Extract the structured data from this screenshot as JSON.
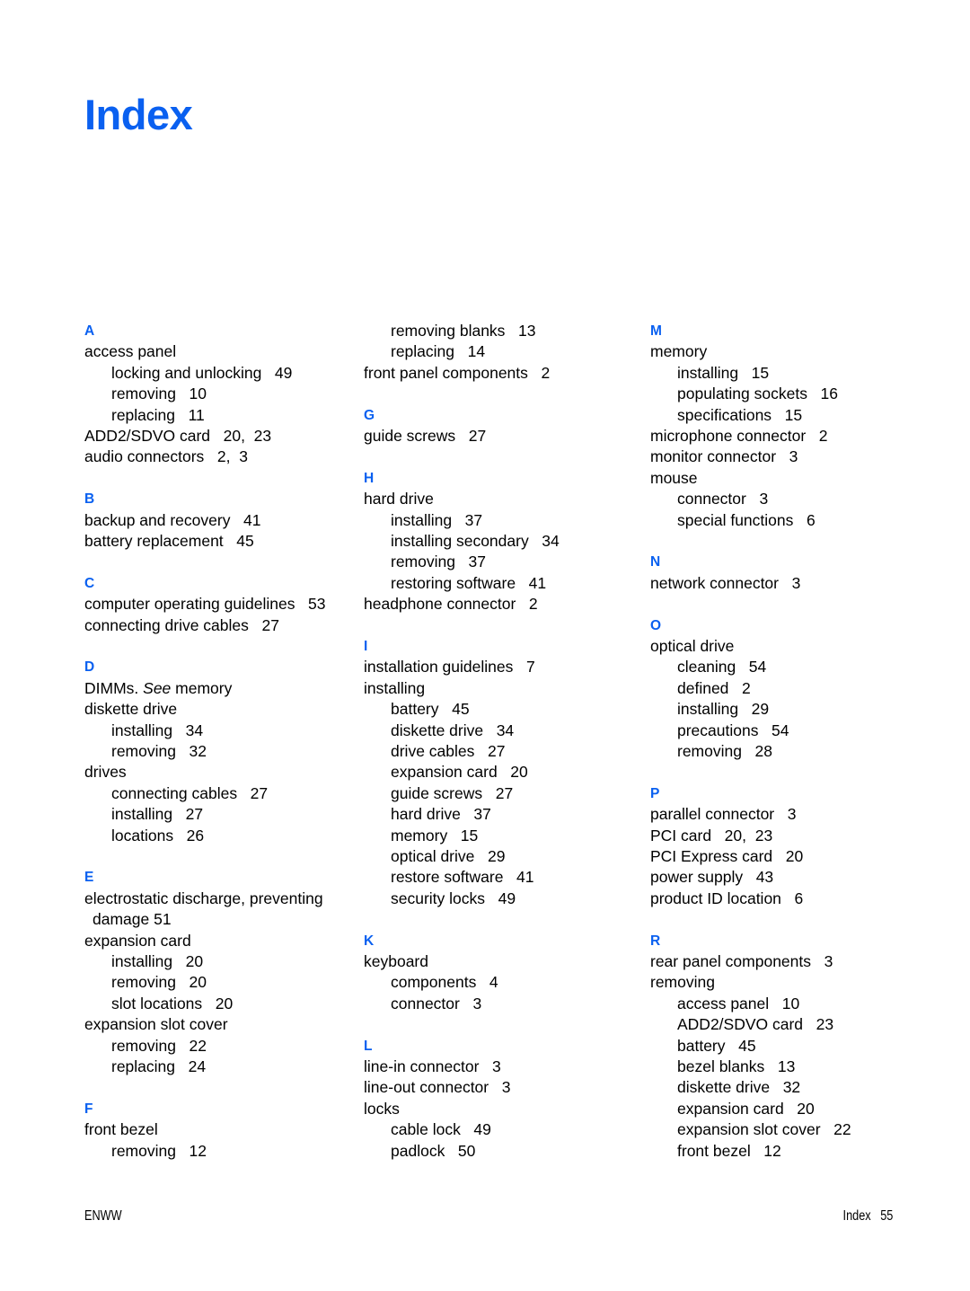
{
  "title": "Index",
  "colors": {
    "heading_blue": "#0a60f0",
    "body_text": "#000000",
    "page_background": "#ffffff"
  },
  "footer": {
    "left": "ENWW",
    "right": "Index   55"
  },
  "columns": [
    {
      "id": "column-1",
      "groups": [
        {
          "letter": "A",
          "entries": [
            {
              "level": 1,
              "text": "access panel"
            },
            {
              "level": 2,
              "text": "locking and unlocking   49"
            },
            {
              "level": 2,
              "text": "removing   10"
            },
            {
              "level": 2,
              "text": "replacing   11"
            },
            {
              "level": 1,
              "text": "ADD2/SDVO card   20,  23"
            },
            {
              "level": 1,
              "text": "audio connectors   2,  3"
            }
          ]
        },
        {
          "letter": "B",
          "entries": [
            {
              "level": 1,
              "text": "backup and recovery   41"
            },
            {
              "level": 1,
              "text": "battery replacement   45"
            }
          ]
        },
        {
          "letter": "C",
          "entries": [
            {
              "level": 1,
              "text": "computer operating guidelines   53"
            },
            {
              "level": 1,
              "text": "connecting drive cables   27"
            }
          ]
        },
        {
          "letter": "D",
          "entries": [
            {
              "level": 1,
              "text": "DIMMs. ",
              "italic": "See",
              "text_after": " memory"
            },
            {
              "level": 1,
              "text": "diskette drive"
            },
            {
              "level": 2,
              "text": "installing   34"
            },
            {
              "level": 2,
              "text": "removing   32"
            },
            {
              "level": 1,
              "text": "drives"
            },
            {
              "level": 2,
              "text": "connecting cables   27"
            },
            {
              "level": 2,
              "text": "installing   27"
            },
            {
              "level": 2,
              "text": "locations   26"
            }
          ]
        },
        {
          "letter": "E",
          "entries": [
            {
              "level": 1,
              "text": "electrostatic discharge, preventing"
            },
            {
              "level": 1,
              "wrap": true,
              "text": "damage   51"
            },
            {
              "level": 1,
              "text": "expansion card"
            },
            {
              "level": 2,
              "text": "installing   20"
            },
            {
              "level": 2,
              "text": "removing   20"
            },
            {
              "level": 2,
              "text": "slot locations   20"
            },
            {
              "level": 1,
              "text": "expansion slot cover"
            },
            {
              "level": 2,
              "text": "removing   22"
            },
            {
              "level": 2,
              "text": "replacing   24"
            }
          ]
        },
        {
          "letter": "F",
          "entries": [
            {
              "level": 1,
              "text": "front bezel"
            },
            {
              "level": 2,
              "text": "removing   12"
            }
          ]
        }
      ]
    },
    {
      "id": "column-2",
      "groups": [
        {
          "letter": "",
          "entries": [
            {
              "level": 2,
              "text": "removing blanks   13"
            },
            {
              "level": 2,
              "text": "replacing   14"
            },
            {
              "level": 1,
              "text": "front panel components   2"
            }
          ]
        },
        {
          "letter": "G",
          "entries": [
            {
              "level": 1,
              "text": "guide screws   27"
            }
          ]
        },
        {
          "letter": "H",
          "entries": [
            {
              "level": 1,
              "text": "hard drive"
            },
            {
              "level": 2,
              "text": "installing   37"
            },
            {
              "level": 2,
              "text": "installing secondary   34"
            },
            {
              "level": 2,
              "text": "removing   37"
            },
            {
              "level": 2,
              "text": "restoring software   41"
            },
            {
              "level": 1,
              "text": "headphone connector   2"
            }
          ]
        },
        {
          "letter": "I",
          "entries": [
            {
              "level": 1,
              "text": "installation guidelines   7"
            },
            {
              "level": 1,
              "text": "installing"
            },
            {
              "level": 2,
              "text": "battery   45"
            },
            {
              "level": 2,
              "text": "diskette drive   34"
            },
            {
              "level": 2,
              "text": "drive cables   27"
            },
            {
              "level": 2,
              "text": "expansion card   20"
            },
            {
              "level": 2,
              "text": "guide screws   27"
            },
            {
              "level": 2,
              "text": "hard drive   37"
            },
            {
              "level": 2,
              "text": "memory   15"
            },
            {
              "level": 2,
              "text": "optical drive   29"
            },
            {
              "level": 2,
              "text": "restore software   41"
            },
            {
              "level": 2,
              "text": "security locks   49"
            }
          ]
        },
        {
          "letter": "K",
          "entries": [
            {
              "level": 1,
              "text": "keyboard"
            },
            {
              "level": 2,
              "text": "components   4"
            },
            {
              "level": 2,
              "text": "connector   3"
            }
          ]
        },
        {
          "letter": "L",
          "entries": [
            {
              "level": 1,
              "text": "line-in connector   3"
            },
            {
              "level": 1,
              "text": "line-out connector   3"
            },
            {
              "level": 1,
              "text": "locks"
            },
            {
              "level": 2,
              "text": "cable lock   49"
            },
            {
              "level": 2,
              "text": "padlock   50"
            }
          ]
        }
      ]
    },
    {
      "id": "column-3",
      "groups": [
        {
          "letter": "M",
          "entries": [
            {
              "level": 1,
              "text": "memory"
            },
            {
              "level": 2,
              "text": "installing   15"
            },
            {
              "level": 2,
              "text": "populating sockets   16"
            },
            {
              "level": 2,
              "text": "specifications   15"
            },
            {
              "level": 1,
              "text": "microphone connector   2"
            },
            {
              "level": 1,
              "text": "monitor connector   3"
            },
            {
              "level": 1,
              "text": "mouse"
            },
            {
              "level": 2,
              "text": "connector   3"
            },
            {
              "level": 2,
              "text": "special functions   6"
            }
          ]
        },
        {
          "letter": "N",
          "entries": [
            {
              "level": 1,
              "text": "network connector   3"
            }
          ]
        },
        {
          "letter": "O",
          "entries": [
            {
              "level": 1,
              "text": "optical drive"
            },
            {
              "level": 2,
              "text": "cleaning   54"
            },
            {
              "level": 2,
              "text": "defined   2"
            },
            {
              "level": 2,
              "text": "installing   29"
            },
            {
              "level": 2,
              "text": "precautions   54"
            },
            {
              "level": 2,
              "text": "removing   28"
            }
          ]
        },
        {
          "letter": "P",
          "entries": [
            {
              "level": 1,
              "text": "parallel connector   3"
            },
            {
              "level": 1,
              "text": "PCI card   20,  23"
            },
            {
              "level": 1,
              "text": "PCI Express card   20"
            },
            {
              "level": 1,
              "text": "power supply   43"
            },
            {
              "level": 1,
              "text": "product ID location   6"
            }
          ]
        },
        {
          "letter": "R",
          "entries": [
            {
              "level": 1,
              "text": "rear panel components   3"
            },
            {
              "level": 1,
              "text": "removing"
            },
            {
              "level": 2,
              "text": "access panel   10"
            },
            {
              "level": 2,
              "text": "ADD2/SDVO card   23"
            },
            {
              "level": 2,
              "text": "battery   45"
            },
            {
              "level": 2,
              "text": "bezel blanks   13"
            },
            {
              "level": 2,
              "text": "diskette drive   32"
            },
            {
              "level": 2,
              "text": "expansion card   20"
            },
            {
              "level": 2,
              "text": "expansion slot cover   22"
            },
            {
              "level": 2,
              "text": "front bezel   12"
            }
          ]
        }
      ]
    }
  ]
}
